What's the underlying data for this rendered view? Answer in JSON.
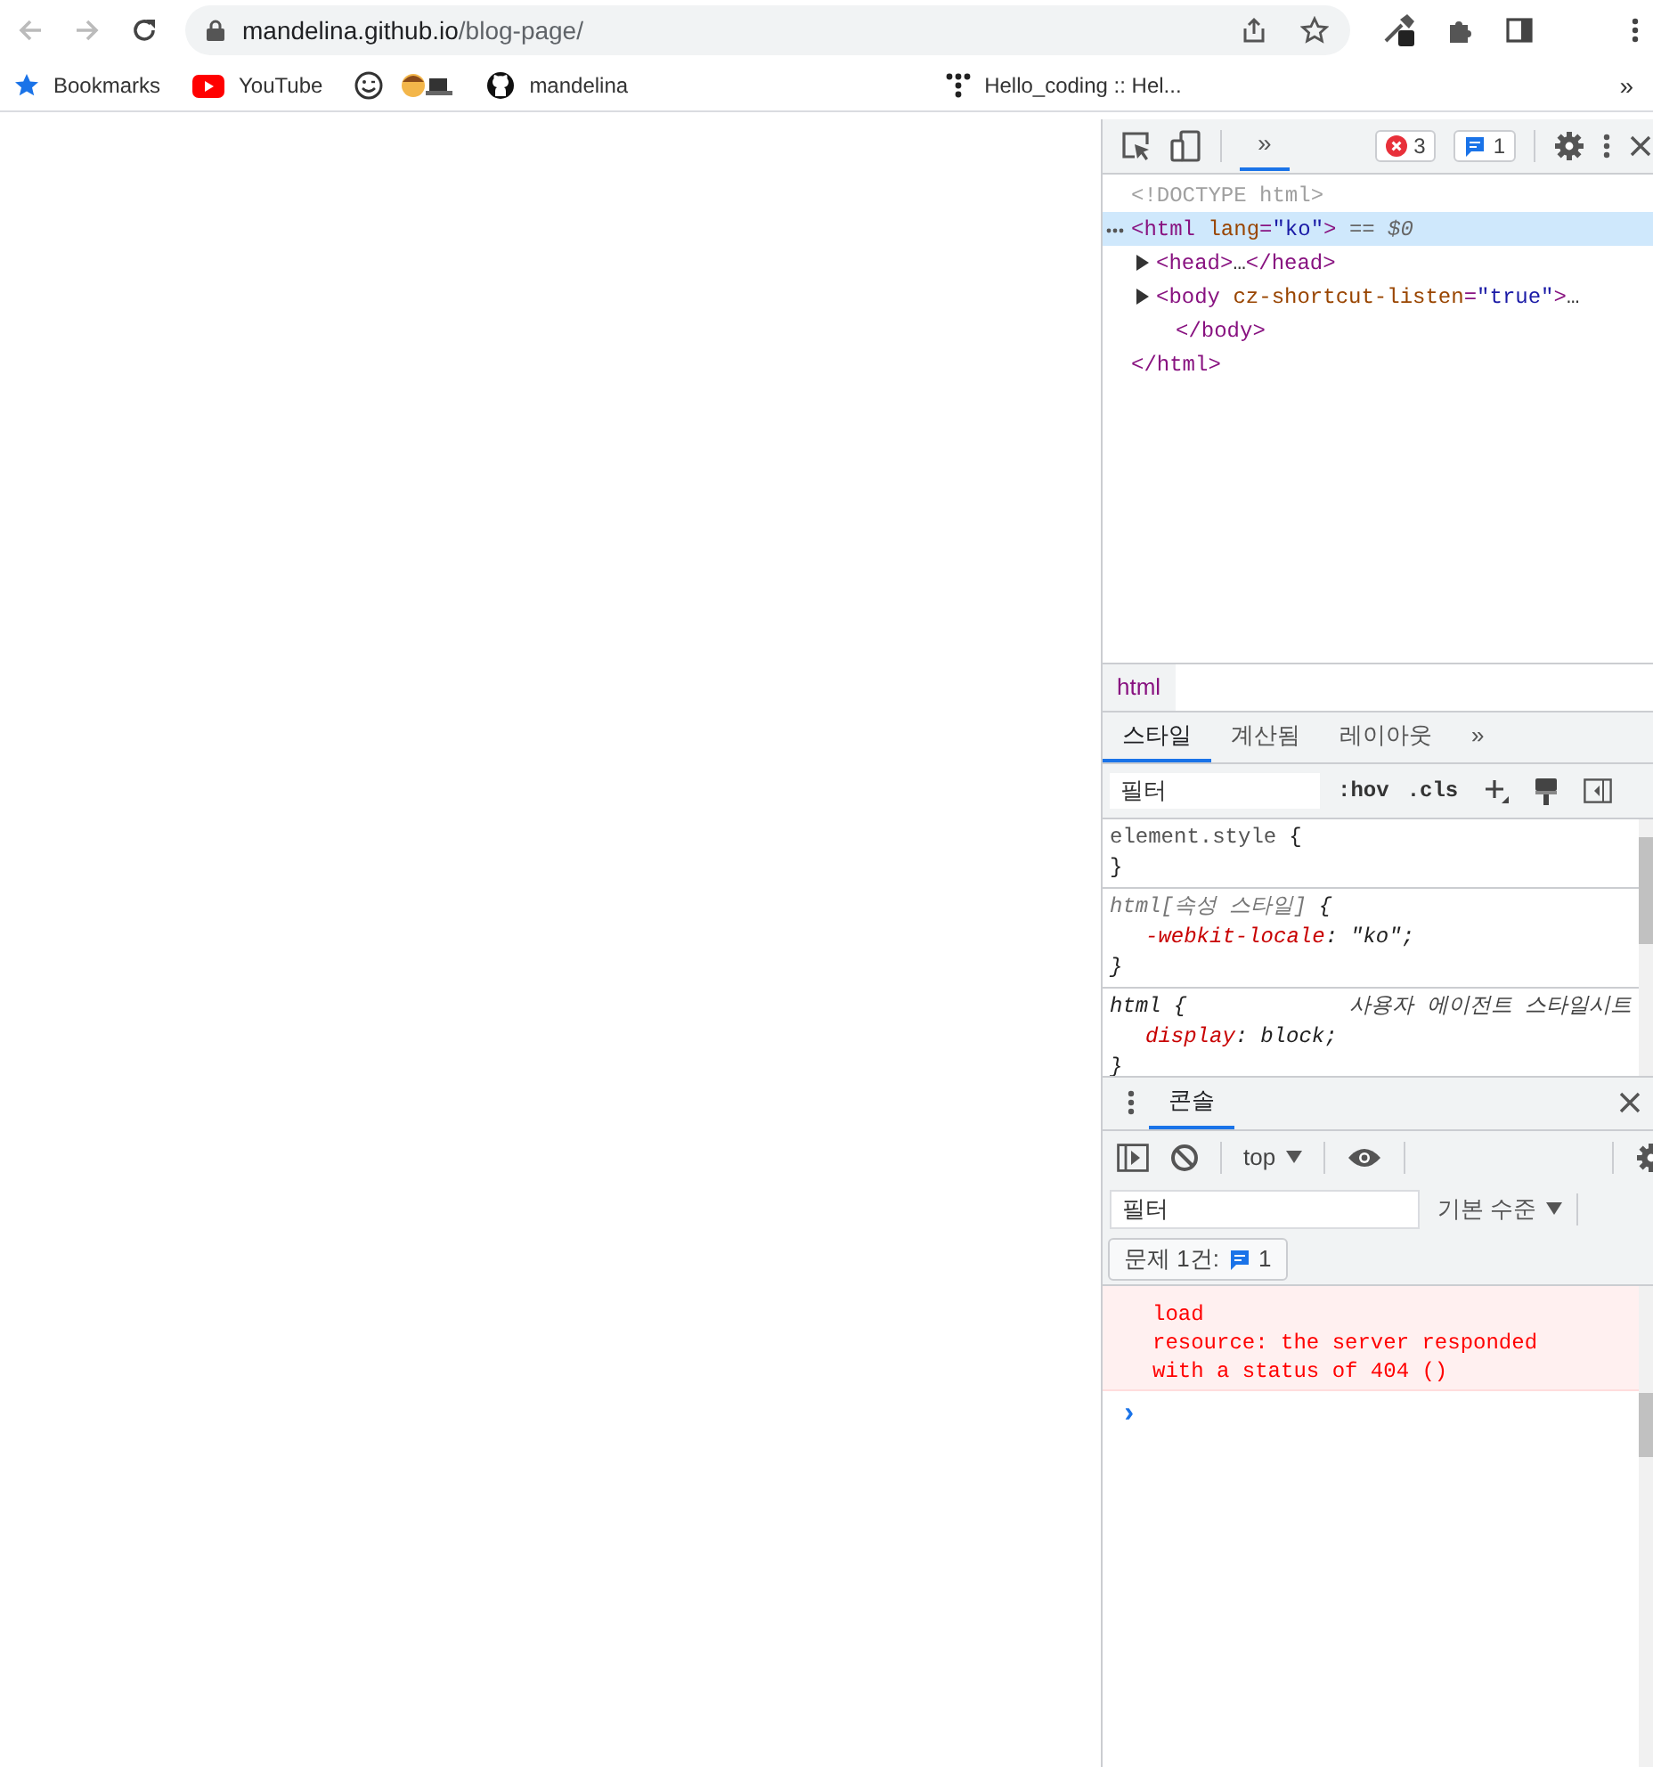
{
  "browser": {
    "address": {
      "domain": "mandelina.github.io",
      "path": "/blog-page/"
    },
    "bookmarks": [
      {
        "kind": "star",
        "label": "Bookmarks"
      },
      {
        "kind": "youtube",
        "label": "YouTube"
      },
      {
        "kind": "smiley"
      },
      {
        "kind": "coder"
      },
      {
        "kind": "github",
        "label": "mandelina"
      },
      {
        "kind": "dots",
        "label": "Hello_coding :: Hel..."
      }
    ],
    "overflow": "»"
  },
  "devtools": {
    "toolbar": {
      "more": "»",
      "errors": "3",
      "messages": "1"
    },
    "dom": [
      {
        "tokens": [
          {
            "kind": "doctype",
            "text": "<!DOCTYPE html>"
          }
        ],
        "selected": false
      },
      {
        "tokens": [
          {
            "kind": "tag",
            "text": "<html"
          },
          {
            "kind": "attr",
            "text": " lang"
          },
          {
            "kind": "tag",
            "text": "="
          },
          {
            "kind": "value",
            "text": "\"ko\""
          },
          {
            "kind": "tag",
            "text": ">"
          },
          {
            "kind": "note",
            "text": " == $0"
          }
        ],
        "selected": true,
        "expanded": true,
        "children": [
          {
            "tokens": [
              {
                "kind": "tag",
                "text": "<head>"
              },
              {
                "kind": "plain",
                "text": "…"
              },
              {
                "kind": "tag",
                "text": "</head>"
              }
            ],
            "selected": false,
            "expanded": false
          },
          {
            "tokens": [
              {
                "kind": "tag",
                "text": "<body"
              },
              {
                "kind": "attr",
                "text": " cz-shortcut-listen"
              },
              {
                "kind": "tag",
                "text": "="
              },
              {
                "kind": "value",
                "text": "\"true\""
              },
              {
                "kind": "tag",
                "text": ">"
              },
              {
                "kind": "plain",
                "text": "…"
              }
            ],
            "closing": "</body>",
            "selected": false,
            "expanded": false
          }
        ],
        "closing": "</html>"
      }
    ],
    "breadcrumb": [
      "html"
    ],
    "style_tabs": [
      {
        "label": "스타일",
        "selected": true
      },
      {
        "label": "계산됨",
        "selected": false
      },
      {
        "label": "레이아웃",
        "selected": false
      }
    ],
    "style_more": "»",
    "style_filter": {
      "placeholder": "필터"
    },
    "style_buttons": [
      ":hov",
      ".cls"
    ],
    "rules": [
      {
        "kind": "inline",
        "selector": "element.style",
        "open": "{",
        "close": "}"
      },
      {
        "kind": "attribute",
        "selector": "html[속성 스타일]",
        "open": "{",
        "declarations": [
          {
            "property": "-webkit-locale",
            "colon": ":",
            "value": "\"ko\"",
            "end": ";"
          }
        ],
        "close": "}"
      },
      {
        "kind": "user-agent",
        "selector": "html",
        "open": "{",
        "source": "사용자 에이전트 스타일시트",
        "declarations": [
          {
            "property": "display",
            "colon": ":",
            "value": "block",
            "end": ";"
          }
        ],
        "close": "}"
      }
    ],
    "drawer_tabs": [
      {
        "label": "콘솔",
        "selected": true
      }
    ],
    "console": {
      "context": "top",
      "filter": {
        "placeholder": "필터"
      },
      "level": "기본 수준",
      "issues": {
        "label": "문제 1건:",
        "count": "1"
      },
      "messages": [
        {
          "kind": "error",
          "lines": [
            "load",
            "resource: the server responded",
            "with a status of 404 ()"
          ]
        }
      ],
      "prompt": "›"
    }
  }
}
